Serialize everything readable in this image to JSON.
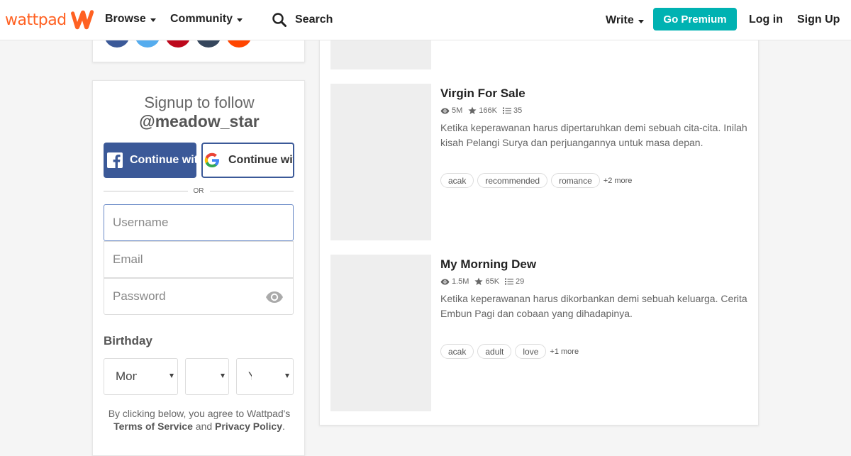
{
  "header": {
    "logo_text": "wattpad",
    "nav": [
      {
        "label": "Browse"
      },
      {
        "label": "Community"
      }
    ],
    "search_label": "Search",
    "write_label": "Write",
    "premium_label": "Go Premium",
    "login_label": "Log in",
    "signup_label": "Sign Up",
    "brand_color": "#ff6122",
    "premium_color": "#00b2b2"
  },
  "share": {
    "colors": [
      "#3b5998",
      "#55acee",
      "#bd081c",
      "#35465c",
      "#ff4500"
    ]
  },
  "signup": {
    "title": "Signup to follow",
    "handle": "@meadow_star",
    "facebook_label": "Continue with Facebook",
    "google_label": "Continue with Google",
    "or_label": "OR",
    "username_placeholder": "Username",
    "email_placeholder": "Email",
    "password_placeholder": "Password",
    "birthday_label": "Birthday",
    "month_value": "Month",
    "day_value": "",
    "year_value": "Year",
    "terms_prefix": "By clicking below, you agree to Wattpad's ",
    "terms_link": "Terms of Service",
    "terms_and": " and ",
    "privacy_link": "Privacy Policy",
    "terms_suffix": "."
  },
  "stories": [
    {
      "title": "Virgin For Sale",
      "reads": "5M",
      "votes": "166K",
      "parts": "35",
      "description": "Ketika keperawanan harus dipertaruhkan demi sebuah cita-cita. Inilah kisah Pelangi Surya dan perjuangannya untuk masa depan.",
      "tags": [
        "acak",
        "recommended",
        "romance"
      ],
      "more": "+2 more"
    },
    {
      "title": "My Morning Dew",
      "reads": "1.5M",
      "votes": "65K",
      "parts": "29",
      "description": "Ketika keperawanan harus dikorbankan demi sebuah keluarga. Cerita Embun Pagi dan cobaan yang dihadapinya.",
      "tags": [
        "acak",
        "adult",
        "love"
      ],
      "more": "+1 more"
    }
  ]
}
